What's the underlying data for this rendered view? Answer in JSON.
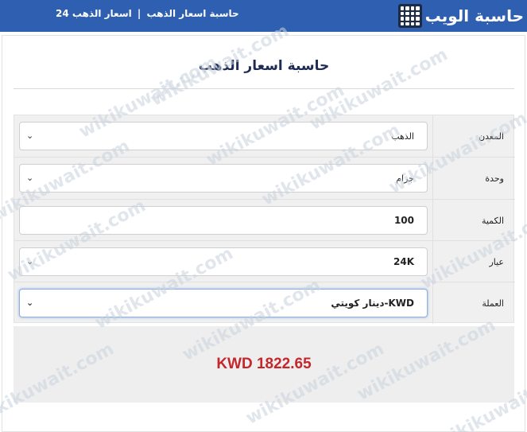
{
  "header": {
    "nav_item_1": "حاسبة اسعار الذهب",
    "nav_separator": "|",
    "nav_item_2": "اسعار الذهب 24",
    "logo_text": "حاسبة الويب"
  },
  "calculator": {
    "title": "حاسبة اسعار الذهب",
    "rows": [
      {
        "label": "المعدن",
        "value": "الذهب"
      },
      {
        "label": "وحدة",
        "value": "جرام"
      },
      {
        "label": "الكمية",
        "value": "100"
      },
      {
        "label": "عيار",
        "value": "24K"
      },
      {
        "label": "العملة",
        "value": "KWD-دينار كويتي"
      }
    ],
    "result": "KWD 1822.65"
  },
  "watermark": "wikikuwait.com",
  "colors": {
    "header_bg": "#2f5fb0",
    "title": "#1f2b55",
    "result": "#c3272b"
  }
}
